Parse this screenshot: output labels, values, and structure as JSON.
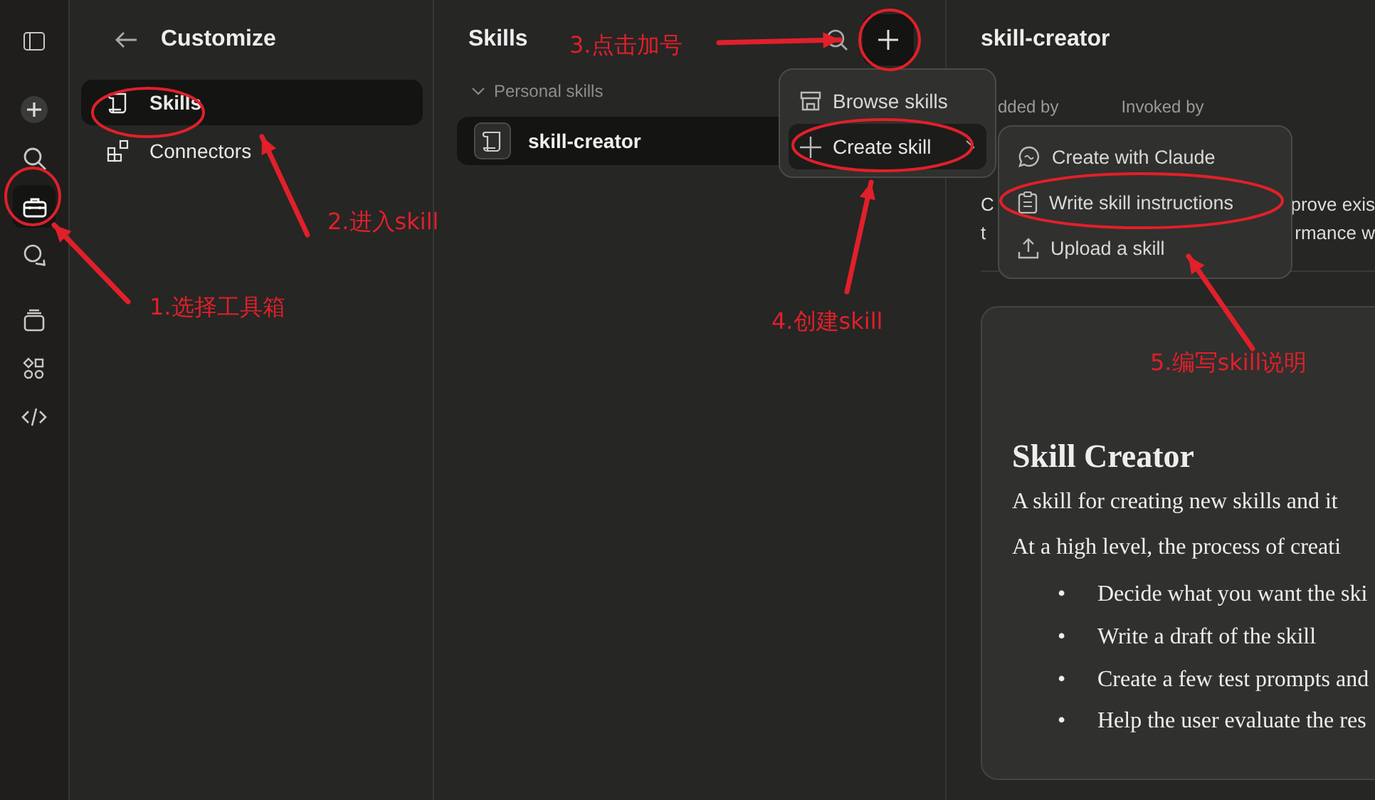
{
  "rail": {
    "items": [
      {
        "kind": "sidebar",
        "selected": false
      },
      {
        "kind": "new",
        "selected": false
      },
      {
        "kind": "search",
        "selected": false
      },
      {
        "kind": "toolbox",
        "selected": true
      },
      {
        "kind": "chats",
        "selected": false
      },
      {
        "kind": "projects",
        "selected": false
      },
      {
        "kind": "artifacts",
        "selected": false
      },
      {
        "kind": "code",
        "selected": false
      }
    ]
  },
  "customize": {
    "title": "Customize",
    "items": [
      {
        "label": "Skills",
        "kind": "skills",
        "selected": true
      },
      {
        "label": "Connectors",
        "kind": "connectors",
        "selected": false
      }
    ]
  },
  "skills_panel": {
    "title": "Skills",
    "section": {
      "label": "Personal skills",
      "expanded": true
    },
    "items": [
      {
        "label": "skill-creator",
        "selected": true
      }
    ]
  },
  "menu": {
    "items": [
      {
        "label": "Browse skills",
        "kind": "browse",
        "highlighted": false,
        "submenu": false
      },
      {
        "label": "Create skill",
        "kind": "create",
        "highlighted": true,
        "submenu": true
      }
    ]
  },
  "submenu": {
    "items": [
      {
        "label": "Create with Claude",
        "kind": "chat"
      },
      {
        "label": "Write skill instructions",
        "kind": "clipboard"
      },
      {
        "label": "Upload a skill",
        "kind": "upload"
      }
    ]
  },
  "detail": {
    "title": "skill-creator",
    "meta": [
      "dded by",
      "Invoked by"
    ],
    "description_fragments": [
      {
        "left": "C",
        "right": "prove exis"
      },
      {
        "left": "t",
        "right": "rmance w"
      }
    ],
    "document": {
      "heading": "Skill Creator",
      "paragraphs": [
        "A skill for creating new skills and it",
        "At a high level, the process of creati"
      ],
      "bullet": "•",
      "bullets": [
        "Decide what you want the ski",
        "Write a draft of the skill",
        "Create a few test prompts and",
        "Help the user evaluate the res"
      ]
    }
  },
  "annotations": [
    {
      "text": "1.选择工具箱"
    },
    {
      "text": "2.进入skill"
    },
    {
      "text": "3.点击加号"
    },
    {
      "text": "4.创建skill"
    },
    {
      "text": "5.编写skill说明"
    }
  ]
}
